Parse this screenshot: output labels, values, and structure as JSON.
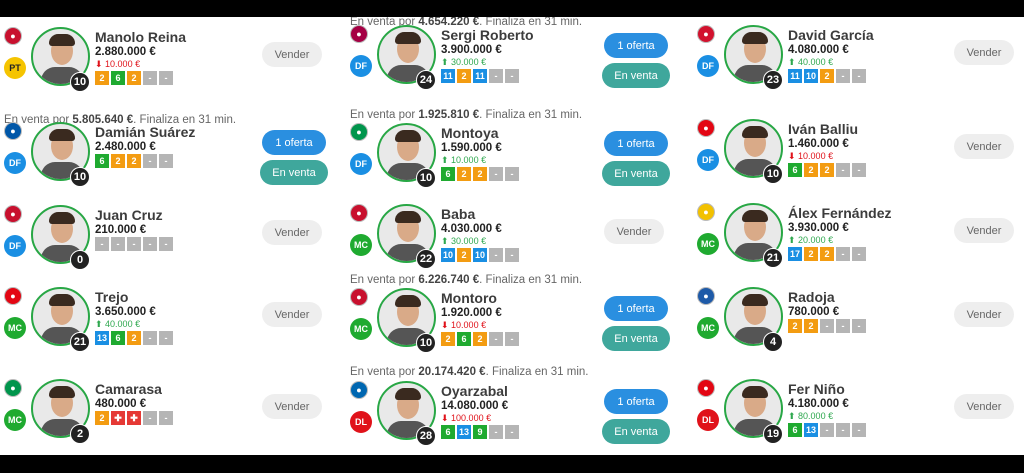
{
  "market": {
    "cards": [
      {
        "name": "Manolo Reina",
        "price": "2.880.000 €",
        "delta": "10.000 €",
        "dir": "down",
        "pos": "PT",
        "num": "10",
        "crest": "#c8102e",
        "pts": [
          [
            "2",
            "orange"
          ],
          [
            "6",
            "green"
          ],
          [
            "2",
            "orange"
          ],
          [
            "-",
            "gray"
          ],
          [
            "-",
            "gray"
          ]
        ],
        "buttons": [
          "Vender"
        ]
      },
      {
        "sale": "En venta por |5.805.640 €|. Finaliza en 31 min.",
        "name": "Damián Suárez",
        "price": "2.480.000 €",
        "pos": "DF",
        "num": "10",
        "crest": "#0057a8",
        "pts": [
          [
            "6",
            "green"
          ],
          [
            "2",
            "orange"
          ],
          [
            "2",
            "orange"
          ],
          [
            "-",
            "gray"
          ],
          [
            "-",
            "gray"
          ]
        ],
        "buttons": [
          "1 oferta",
          "En venta"
        ]
      },
      {
        "name": "Juan Cruz",
        "price": "210.000 €",
        "pos": "DF",
        "num": "0",
        "crest": "#c8102e",
        "pts": [
          [
            "-",
            "gray"
          ],
          [
            "-",
            "gray"
          ],
          [
            "-",
            "gray"
          ],
          [
            "-",
            "gray"
          ],
          [
            "-",
            "gray"
          ]
        ],
        "buttons": [
          "Vender"
        ]
      },
      {
        "name": "Trejo",
        "price": "3.650.000 €",
        "delta": "40.000 €",
        "dir": "up",
        "pos": "MC",
        "num": "21",
        "crest": "#e30613",
        "pts": [
          [
            "13",
            "blue"
          ],
          [
            "6",
            "green"
          ],
          [
            "2",
            "orange"
          ],
          [
            "-",
            "gray"
          ],
          [
            "-",
            "gray"
          ]
        ],
        "buttons": [
          "Vender"
        ]
      },
      {
        "name": "Camarasa",
        "price": "480.000 €",
        "pos": "MC",
        "num": "2",
        "crest": "#00954c",
        "pts": [
          [
            "2",
            "orange"
          ],
          [
            "✚",
            "red"
          ],
          [
            "✚",
            "red"
          ],
          [
            "-",
            "gray"
          ],
          [
            "-",
            "gray"
          ]
        ],
        "buttons": [
          "Vender"
        ]
      },
      {
        "sale": "En venta por |4.654.220 €|. Finaliza en 31 min.",
        "name": "Sergi Roberto",
        "price": "3.900.000 €",
        "delta": "30.000 €",
        "dir": "up",
        "pos": "DF",
        "num": "24",
        "crest": "#a50044",
        "pts": [
          [
            "11",
            "blue"
          ],
          [
            "2",
            "orange"
          ],
          [
            "11",
            "blue"
          ],
          [
            "-",
            "gray"
          ],
          [
            "-",
            "gray"
          ]
        ],
        "buttons": [
          "1 oferta",
          "En venta"
        ]
      },
      {
        "sale": "En venta por |1.925.810 €|. Finaliza en 31 min.",
        "name": "Montoya",
        "price": "1.590.000 €",
        "delta": "10.000 €",
        "dir": "up",
        "pos": "DF",
        "num": "10",
        "crest": "#00954c",
        "pts": [
          [
            "6",
            "green"
          ],
          [
            "2",
            "orange"
          ],
          [
            "2",
            "orange"
          ],
          [
            "-",
            "gray"
          ],
          [
            "-",
            "gray"
          ]
        ],
        "buttons": [
          "1 oferta",
          "En venta"
        ]
      },
      {
        "name": "Baba",
        "price": "4.030.000 €",
        "delta": "30.000 €",
        "dir": "up",
        "pos": "MC",
        "num": "22",
        "crest": "#c8102e",
        "pts": [
          [
            "10",
            "blue"
          ],
          [
            "2",
            "orange"
          ],
          [
            "10",
            "blue"
          ],
          [
            "-",
            "gray"
          ],
          [
            "-",
            "gray"
          ]
        ],
        "buttons": [
          "Vender"
        ]
      },
      {
        "sale": "En venta por |6.226.740 €|. Finaliza en 31 min.",
        "name": "Montoro",
        "price": "1.920.000 €",
        "delta": "10.000 €",
        "dir": "down",
        "pos": "MC",
        "num": "10",
        "crest": "#c8102e",
        "pts": [
          [
            "2",
            "orange"
          ],
          [
            "6",
            "green"
          ],
          [
            "2",
            "orange"
          ],
          [
            "-",
            "gray"
          ],
          [
            "-",
            "gray"
          ]
        ],
        "buttons": [
          "1 oferta",
          "En venta"
        ]
      },
      {
        "sale": "En venta por |20.174.420 €|. Finaliza en 31 min.",
        "name": "Oyarzabal",
        "price": "14.080.000 €",
        "delta": "100.000 €",
        "dir": "down",
        "pos": "DL",
        "num": "28",
        "crest": "#0067b1",
        "pts": [
          [
            "6",
            "green"
          ],
          [
            "13",
            "blue"
          ],
          [
            "9",
            "green"
          ],
          [
            "-",
            "gray"
          ],
          [
            "-",
            "gray"
          ]
        ],
        "buttons": [
          "1 oferta",
          "En venta"
        ]
      },
      {
        "name": "David García",
        "price": "4.080.000 €",
        "delta": "40.000 €",
        "dir": "up",
        "pos": "DF",
        "num": "23",
        "crest": "#d2122e",
        "pts": [
          [
            "11",
            "blue"
          ],
          [
            "10",
            "blue"
          ],
          [
            "2",
            "orange"
          ],
          [
            "-",
            "gray"
          ],
          [
            "-",
            "gray"
          ]
        ],
        "buttons": [
          "Vender"
        ]
      },
      {
        "name": "Iván Balliu",
        "price": "1.460.000 €",
        "delta": "10.000 €",
        "dir": "down",
        "pos": "DF",
        "num": "10",
        "crest": "#e30613",
        "pts": [
          [
            "6",
            "green"
          ],
          [
            "2",
            "orange"
          ],
          [
            "2",
            "orange"
          ],
          [
            "-",
            "gray"
          ],
          [
            "-",
            "gray"
          ]
        ],
        "buttons": [
          "Vender"
        ]
      },
      {
        "name": "Álex Fernández",
        "price": "3.930.000 €",
        "delta": "20.000 €",
        "dir": "up",
        "pos": "MC",
        "num": "21",
        "crest": "#f2c100",
        "pts": [
          [
            "17",
            "blue"
          ],
          [
            "2",
            "orange"
          ],
          [
            "2",
            "orange"
          ],
          [
            "-",
            "gray"
          ],
          [
            "-",
            "gray"
          ]
        ],
        "buttons": [
          "Vender"
        ]
      },
      {
        "name": "Radoja",
        "price": "780.000 €",
        "pos": "MC",
        "num": "4",
        "crest": "#1e5aa8",
        "pts": [
          [
            "2",
            "orange"
          ],
          [
            "2",
            "orange"
          ],
          [
            "-",
            "gray"
          ],
          [
            "-",
            "gray"
          ],
          [
            "-",
            "gray"
          ]
        ],
        "buttons": [
          "Vender"
        ]
      },
      {
        "name": "Fer Niño",
        "price": "4.180.000 €",
        "delta": "80.000 €",
        "dir": "up",
        "pos": "DL",
        "num": "19",
        "crest": "#e30613",
        "pts": [
          [
            "6",
            "green"
          ],
          [
            "13",
            "blue"
          ],
          [
            "-",
            "gray"
          ],
          [
            "-",
            "gray"
          ],
          [
            "-",
            "gray"
          ]
        ],
        "buttons": [
          "Vender"
        ]
      }
    ]
  }
}
